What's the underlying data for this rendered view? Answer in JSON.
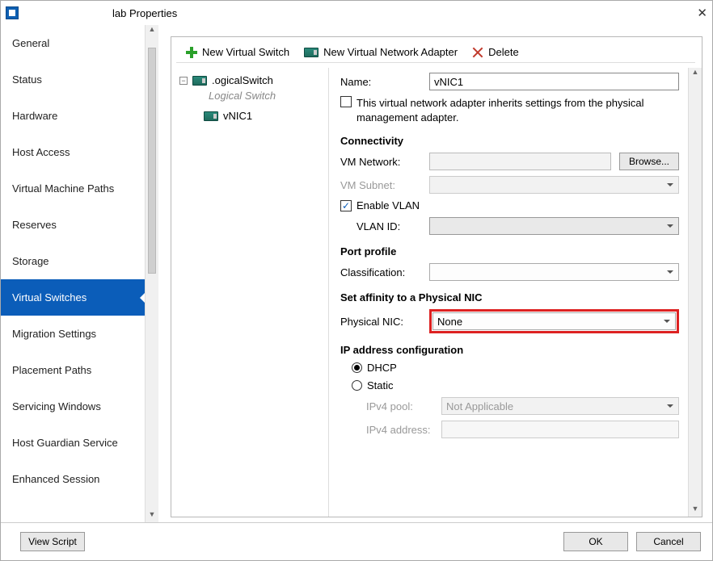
{
  "titlebar": {
    "title": "lab Properties"
  },
  "sidebar": {
    "items": [
      {
        "label": "General"
      },
      {
        "label": "Status"
      },
      {
        "label": "Hardware"
      },
      {
        "label": "Host Access"
      },
      {
        "label": "Virtual Machine Paths"
      },
      {
        "label": "Reserves"
      },
      {
        "label": "Storage"
      },
      {
        "label": "Virtual Switches"
      },
      {
        "label": "Migration Settings"
      },
      {
        "label": "Placement Paths"
      },
      {
        "label": "Servicing Windows"
      },
      {
        "label": "Host Guardian Service"
      },
      {
        "label": "Enhanced Session"
      }
    ],
    "selected_index": 7
  },
  "toolbar": {
    "new_switch": "New Virtual Switch",
    "new_adapter": "New Virtual Network Adapter",
    "delete": "Delete"
  },
  "tree": {
    "switch_name": ".ogicalSwitch",
    "switch_subtitle": "Logical Switch",
    "child_name": "vNIC1"
  },
  "form": {
    "name_label": "Name:",
    "name_value": "vNIC1",
    "inherit_checked": false,
    "inherit_label": "This virtual network adapter inherits settings from the physical management adapter.",
    "connectivity_header": "Connectivity",
    "vm_network_label": "VM Network:",
    "vm_network_value": "",
    "browse_label": "Browse...",
    "vm_subnet_label": "VM Subnet:",
    "vm_subnet_value": "",
    "enable_vlan_checked": true,
    "enable_vlan_label": "Enable VLAN",
    "vlan_id_label": "VLAN ID:",
    "vlan_id_value": "",
    "port_profile_header": "Port profile",
    "classification_label": "Classification:",
    "classification_value": "",
    "affinity_header": "Set affinity to a Physical NIC",
    "physical_nic_label": "Physical NIC:",
    "physical_nic_value": "None",
    "ipconfig_header": "IP address configuration",
    "dhcp_label": "DHCP",
    "static_label": "Static",
    "ip_mode": "dhcp",
    "ipv4_pool_label": "IPv4 pool:",
    "ipv4_pool_value": "Not Applicable",
    "ipv4_addr_label": "IPv4 address:",
    "ipv4_addr_value": ""
  },
  "footer": {
    "view_script": "View Script",
    "ok": "OK",
    "cancel": "Cancel"
  }
}
